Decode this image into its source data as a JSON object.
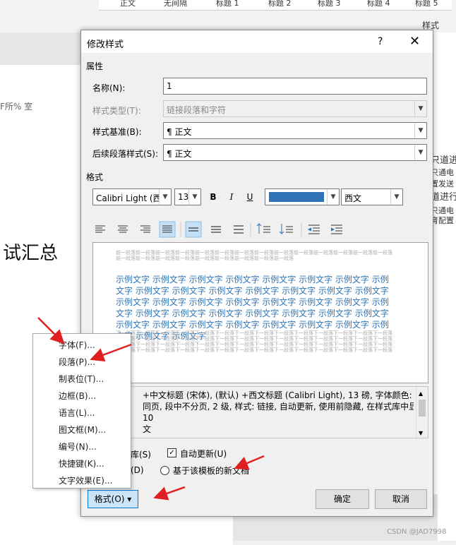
{
  "background": {
    "ribbon_styles": [
      "正文",
      "无间隔",
      "标题 1",
      "标题 2",
      "标题 3",
      "标题 4",
      "标题 5"
    ],
    "styles_group_label": "样式",
    "doc_fragment": "F所%    室",
    "doc_heading": "试汇总",
    "right_fragments": [
      "只道进",
      "只通电",
      "置发送",
      "道进行",
      "只通电",
      "育配置 P"
    ]
  },
  "dialog": {
    "title": "修改样式",
    "help_label": "?",
    "close_label": "✕",
    "properties_header": "属性",
    "name_label": "名称(N):",
    "name_value": "1",
    "style_type_label": "样式类型(T):",
    "style_type_value": "链接段落和字符",
    "based_on_label": "样式基准(B):",
    "based_on_value": "¶ 正文",
    "following_label": "后续段落样式(S):",
    "following_value": "¶ 正文",
    "format_header": "格式",
    "font_value": "Calibri Light (西",
    "size_value": "13",
    "bold": "B",
    "italic": "I",
    "underline": "U",
    "script_value": "西文",
    "preview_prev_text": "前一段落前一段落前一段落前一段落前一段落前一段落前一段落前一段落前一段落前一段落前一段落前一段落前一段落前一段落前一段落前一段落前一段落前一段落前一段落前一段落前一段落前一段落前一段落",
    "preview_sample": "示例文字 示例文字 示例文字 示例文字 示例文字 示例文字 示例文字 示例文字 示例文字 示例文字 示例文字 示例文字 示例文字 示例文字 示例文字 示例文字 示例文字 示例文字 示例文字 示例文字 示例文字 示例文字 示例文字 示例文字 示例文字 示例文字 示例文字 示例文字 示例文字 示例文字 示例文字 示例文字 示例文字 示例文字 示例文字 示例文字 示例文字 示例文字 示例文字 示例文字",
    "preview_next_text": "下一段落下一段落下一段落下一段落下一段落下一段落下一段落下一段落下一段落下一段落下一段落下一段落下一段落下一段落下一段落下一段落下一段落下一段落下一段落下一段落下一段落下一段落下一段落下一段落下一段落下一段落下一段落下一段落下一段落下一段落下一段落下一段落下一段落下一段落下一段落下一段落下一段落下一段落下一段落下一段落下一段落下一段落下一段落下一段落下一段落下一段落下一段落下一段落下一段落下一段落下一段落下一段落下一段落下一段落下一段落下一段落",
    "description_lines": [
      "+中文标题 (宋体), (默认) +西文标题 (Calibri Light), 13 磅, 字体颜色: 着",
      "同页, 段中不分页, 2 级, 样式: 链接, 自动更新, 使用前隐藏, 在样式库中显",
      "10",
      "文"
    ],
    "add_to_gallery": "库(S)",
    "auto_update": "自动更新(U)",
    "only_this_doc": "(D)",
    "new_docs_template": "基于该模板的新文档",
    "ok_label": "确定",
    "cancel_label": "取消",
    "format_button": "格式(O) ▾"
  },
  "format_menu": {
    "items": [
      "字体(F)...",
      "段落(P)...",
      "制表位(T)...",
      "边框(B)...",
      "语言(L)...",
      "图文框(M)...",
      "编号(N)...",
      "快捷键(K)...",
      "文字效果(E)..."
    ]
  },
  "colors": {
    "font_color": "#2e74b5",
    "arrow": "#e02020"
  },
  "watermark": "CSDN @JAD7998"
}
